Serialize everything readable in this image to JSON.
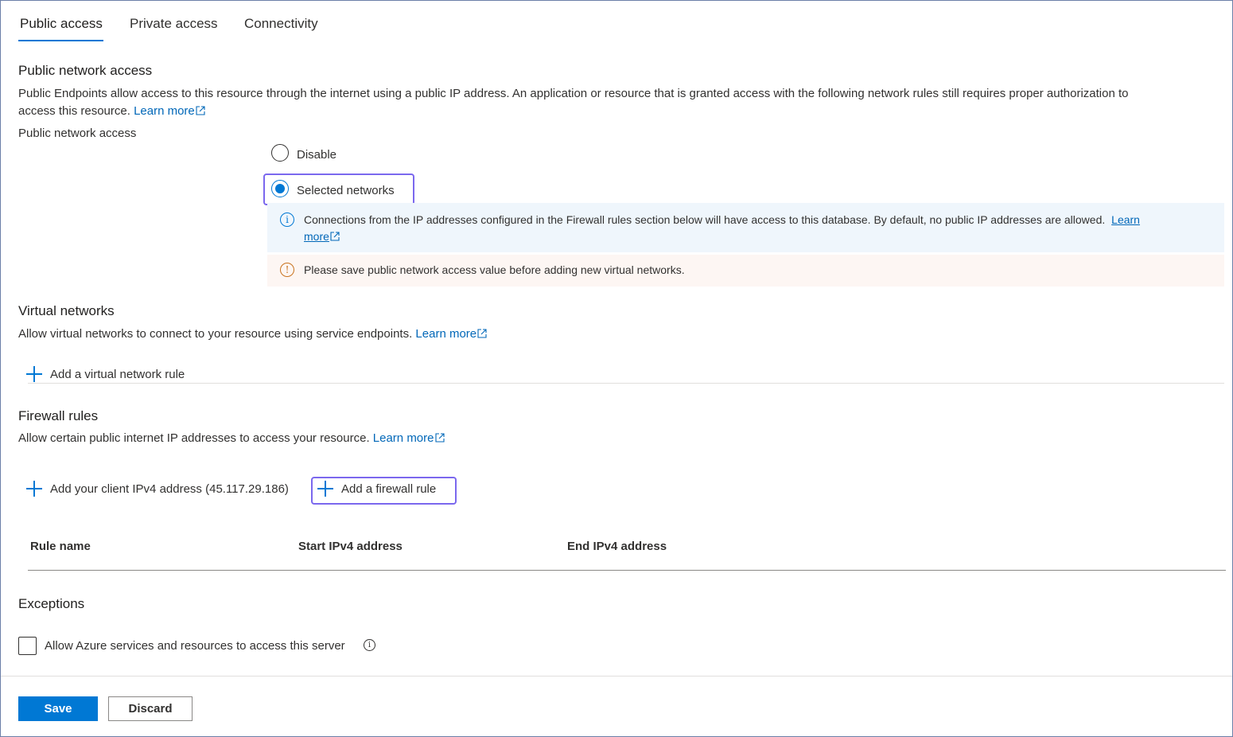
{
  "tabs": [
    {
      "label": "Public access",
      "active": true
    },
    {
      "label": "Private access",
      "active": false
    },
    {
      "label": "Connectivity",
      "active": false
    }
  ],
  "public_access": {
    "title": "Public network access",
    "desc_line1": "Public Endpoints allow access to this resource through the internet using a public IP address. An application or resource that is granted access with the following network rules still requires proper authorization to",
    "desc_line2": "access this resource.",
    "learn_more": "Learn more",
    "field_label": "Public network access",
    "options": [
      {
        "label": "Disable",
        "checked": false
      },
      {
        "label": "Selected networks",
        "checked": true
      }
    ],
    "info_line1": "Connections from the IP addresses configured in the Firewall rules section below will have access to this database. By default, no public IP addresses are allowed.",
    "info_link_part1": "Learn",
    "info_link_part2": "more",
    "warning": "Please save public network access value before adding new virtual networks."
  },
  "virtual_networks": {
    "title": "Virtual networks",
    "desc": "Allow virtual networks to connect to your resource using service endpoints.",
    "learn_more": "Learn more",
    "add_rule": "Add a virtual network rule"
  },
  "firewall": {
    "title": "Firewall rules",
    "desc": "Allow certain public internet IP addresses to access your resource.",
    "learn_more": "Learn more",
    "add_client_ip": "Add your client IPv4 address (45.117.29.186)",
    "add_rule": "Add a firewall rule",
    "columns": [
      "Rule name",
      "Start IPv4 address",
      "End IPv4 address"
    ]
  },
  "exceptions": {
    "title": "Exceptions",
    "allow_azure": "Allow Azure services and resources to access this server",
    "allow_azure_checked": false
  },
  "footer": {
    "save": "Save",
    "discard": "Discard"
  },
  "colors": {
    "accent": "#0078d4",
    "link": "#0067b8",
    "focus": "#7b68ee",
    "info_bg": "#eff6fc",
    "warning_bg": "#fdf6f3",
    "warning_icon": "#c9731e"
  }
}
